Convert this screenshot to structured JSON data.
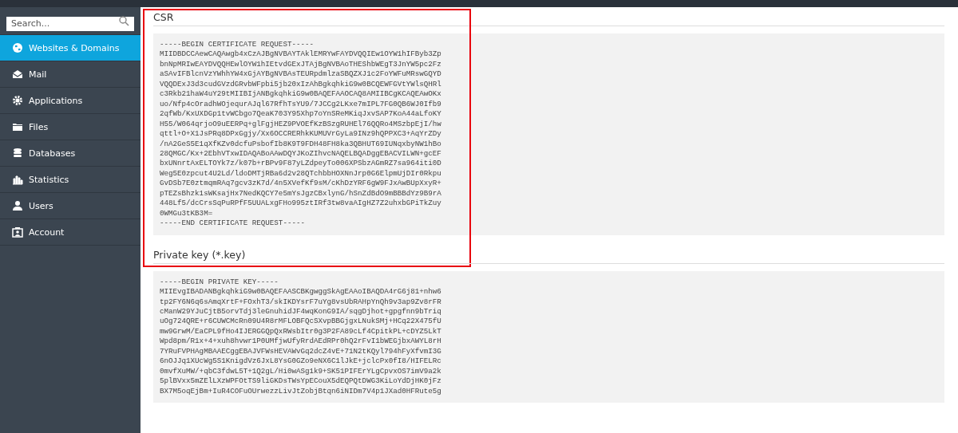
{
  "sidebar": {
    "search": {
      "placeholder": "Search..."
    },
    "items": [
      {
        "label": "Websites & Domains",
        "selected": true
      },
      {
        "label": "Mail",
        "selected": false
      },
      {
        "label": "Applications",
        "selected": false
      },
      {
        "label": "Files",
        "selected": false
      },
      {
        "label": "Databases",
        "selected": false
      },
      {
        "label": "Statistics",
        "selected": false
      },
      {
        "label": "Users",
        "selected": false
      },
      {
        "label": "Account",
        "selected": false
      }
    ]
  },
  "sections": [
    {
      "title": "CSR",
      "highlighted": true,
      "lines": [
        "-----BEGIN CERTIFICATE REQUEST-----",
        "MIIDBDCCAewCAQAwgb4xCzAJBgNVBAYTAklEMRYwFAYDVQQIEw1OYW1hIFByb3Zp",
        "bnNpMRIwEAYDVQQHEwlOYW1hIEtvdGExJTAjBgNVBAoTHEShbWEgT3JnYW5pc2Fz",
        "aSAvIFBlcnVzYWhhYW4xGjAYBgNVBAsTEURpdmlzaSBQZXJ1c2FoYWFuMRswGQYD",
        "VQQDExJ3d3cudGVzdGRvbWFpbi5jb20xIzAhBgkqhkiG9w0BCQEWFGVtYWlsQHRl",
        "c3Rkb21haW4uY29tMIIBIjANBgkqhkiG9w0BAQEFAAOCAQ8AMIIBCgKCAQEAwOKx",
        "uo/Nfp4cOradhWOjequrAJql67RfhTsYU9/7JCCg2LKxe7mIPL7FG0QB6WJ0Ifb9",
        "2qfWb/KxUXDGp1tvWCbgo7QeaK703Y95Xhp7oYnSReMKiqJxvSAP7KoA44aLfoKY",
        "H55/W064qrjoO9uEERPq+glFgjHEZ9PVOEfKzBSzgRUHEl76QQRo4MSzbpEjI/hw",
        "qttl+O+X1JsPRq8DPxGgjy/Xx6OCCRERhkKUMUVrGyLa9INz9hQPPXC3+AqYrZDy",
        "/nA2GeS5E1qXfKZv0dcfuPsbofIb8K9T9FDH48FH8ka3QBHUT69IUNqxbyNW1hBo",
        "28QMGC/Kx+2EbhVTxwIDAQABoAAwDQYJKoZIhvcNAQELBQADggEBACVILWN+gcEF",
        "bxUNnrtAxELTOYk7z/k07b+rBPv9F87yLZdpeyTo006XPSbzAGmRZ7sa964iti0D",
        "Weg5E0zpcut4U2Ld/ldoDMTjRBa6d2v28QTchbbHOXNnJrp0G6ElpmUjDIr0Rkpu",
        "GvDSb7E0ztmqmRAq7gcv3zK7d/4n5XVefKf9sM/cKhDzYRF6gW9FJxAwBUpXxyR+",
        "pTEZsBhzk1sWKsajHx7NedKQCY7e5mYsJgzCBxlynG/hSnZdBdO9mBBBdYz9B9rA",
        "448Lf5/dcCrsSqPuRPfF5UUALxgFHo995ztIRf3tw8vaAIgHZ7Z2uhxbGPiTkZuy",
        "0WMGu3tKB3M=",
        "-----END CERTIFICATE REQUEST-----"
      ]
    },
    {
      "title": "Private key (*.key)",
      "highlighted": false,
      "lines": [
        "-----BEGIN PRIVATE KEY-----",
        "MIIEvgIBADANBgkqhkiG9w0BAQEFAASCBKgwggSkAgEAAoIBAQDA4rG6j81+nhw6",
        "tp2FY6N6q6sAmqXrtF+FOxhT3/skIKDYsrF7uYg8vsUbRAHpYnQh9v3ap9Zv8rFR",
        "cManW29YJuCjtB5orvTdj3leGnuhidJF4wqKonG9IA/sqgDjhot+gpgfnn9bTriq",
        "uOg724QRE+r6CUWCMcRn09U4R8rMFLOBFQcSXvpBBGjgxLNukSMj+HCq22X475fU",
        "mw9GrwM/EaCPL9fHo4IJERGGQpQxRWsbItr0g3P2FA89cLf4CpitkPL+cDYZ5LkT",
        "Wpd8pm/R1x+4+xuh8hvwr1P0UMfjwUfyRrdAEdRPr0hQ2rFvI1bWEGjbxAWYL8rH",
        "7YRuFVPHAgMBAAECggEBAJVFWsHEVAWvGq2dcZ4vE+71N2tKQyl794hFyXfvmI3G",
        "6nOJJq1XUcWg5S1KnigdVz6JxL8YsG0GZo9eNX6C1lJkE+jclcPx0fI8/HIFELRc",
        "0mvfXuMW/+qbC3fdwL5T+1Q2gL/Hi0wASg1k9+SK51PIFErYLgCpvxOS7imV9a2k",
        "5plBVxx5mZElLXzWPFOtTS9liGKDsTWsYpECouX5dEQPQtDWG3KiLoYdDjHK0jFz",
        "BX7M5oqEjBm+IuR4COFuOUrwezzLivJtZobjBtqn6iNIDm7V4p1JXad0HFRute5g"
      ]
    }
  ]
}
